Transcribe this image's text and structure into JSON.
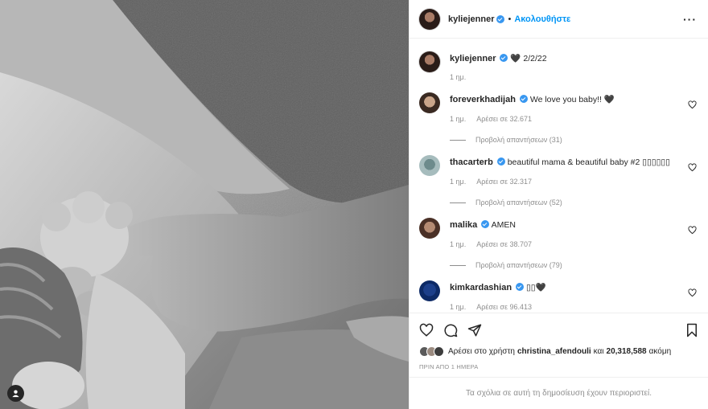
{
  "header": {
    "username": "kyliejenner",
    "dot": "•",
    "follow_label": "Ακολουθήστε",
    "more_label": "···"
  },
  "caption": {
    "username": "kyliejenner",
    "text": "🖤 2/2/22",
    "time": "1 ημ."
  },
  "comments": [
    {
      "username": "foreverkhadijah",
      "text": "We love you baby!! 🖤",
      "time": "1 ημ.",
      "likes": "Αρέσει σε 32.671",
      "replies": "Προβολή απαντήσεων (31)"
    },
    {
      "username": "thacarterb",
      "text": "beautiful mama & beautiful baby #2 ▯▯▯▯▯▯",
      "time": "1 ημ.",
      "likes": "Αρέσει σε 32.317",
      "replies": "Προβολή απαντήσεων (52)"
    },
    {
      "username": "malika",
      "text": "AMEN",
      "time": "1 ημ.",
      "likes": "Αρέσει σε 38.707",
      "replies": "Προβολή απαντήσεων (79)"
    },
    {
      "username": "kimkardashian",
      "text": "▯▯🖤",
      "time": "1 ημ.",
      "likes": "Αρέσει σε 96.413"
    }
  ],
  "likes": {
    "prefix": "Αρέσει στο χρήστη",
    "user": "christina_afendouli",
    "middle": "και",
    "count": "20,318,588",
    "suffix": "ακόμη"
  },
  "timestamp": "ΠΡΙΝ ΑΠΟ 1 ΗΜΕΡΑ",
  "restricted_text": "Τα σχόλια σε αυτή τη δημοσίευση έχουν περιοριστεί.",
  "colors": {
    "accent": "#0095f6",
    "verified": "#3897f0",
    "muted": "#8e8e8e",
    "text": "#262626"
  },
  "icons": [
    "heart-icon",
    "comment-icon",
    "share-icon",
    "bookmark-icon",
    "more-icon",
    "verified-icon",
    "user-tag-icon"
  ]
}
